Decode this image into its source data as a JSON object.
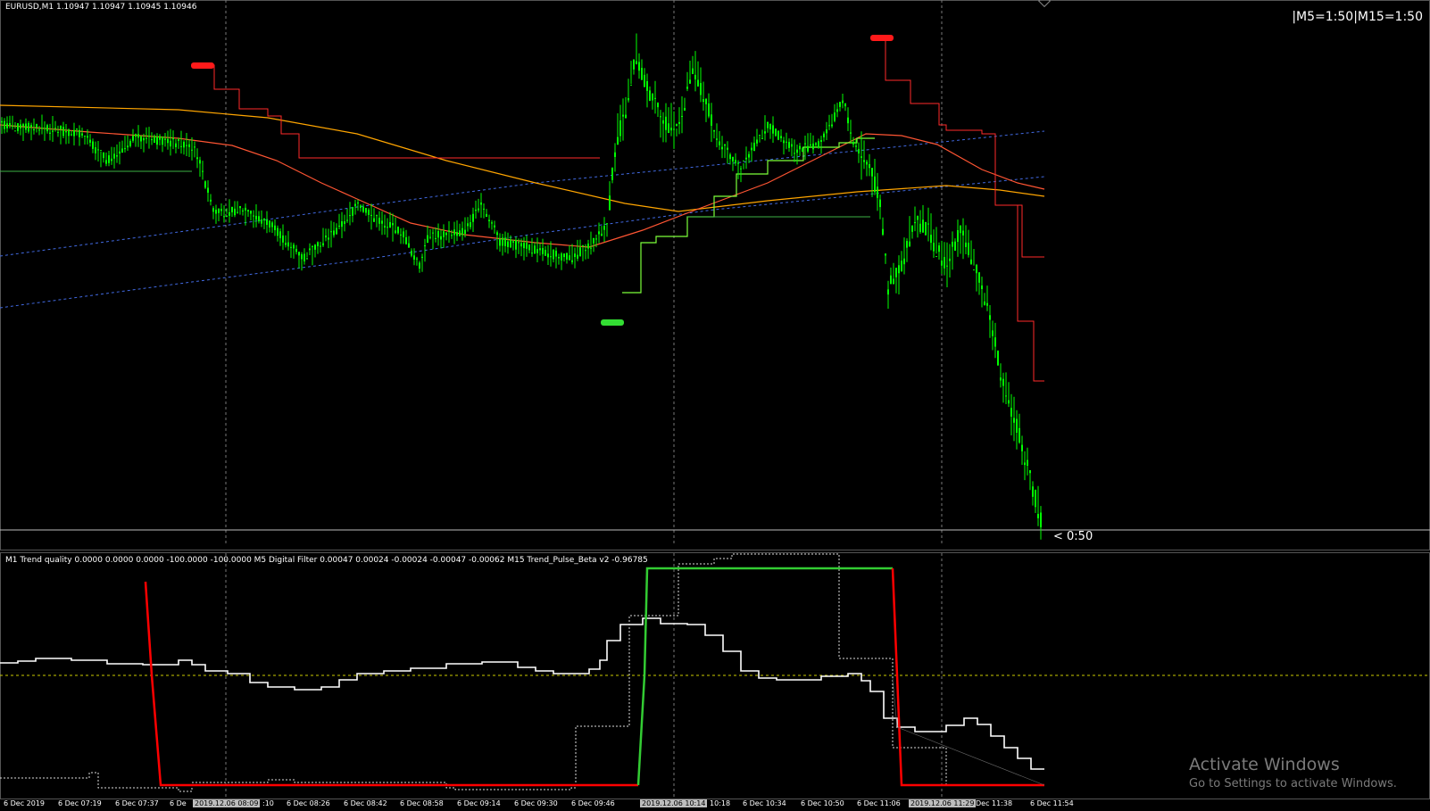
{
  "header": {
    "symbol": "EURUSD,M1  1.10947 1.10947 1.10945 1.10946",
    "timeframes": "|M5=1:50|M15=1:50",
    "countdown": "< 0:50"
  },
  "subwindow": {
    "indicator_label": "M1 Trend quality 0.0000 0.0000 0.0000 -100.0000 -100.0000  M5 Digital Filter 0.00047 0.00024 -0.00024 -0.00047 -0.00062  M15 Trend_Pulse_Beta v2 -0.96785"
  },
  "time_axis": {
    "ticks": [
      {
        "label": "6 Dec 2019",
        "highlight": false
      },
      {
        "label": "6 Dec 07:19",
        "highlight": false
      },
      {
        "label": "6 Dec 07:37",
        "highlight": false
      },
      {
        "label": "6 De",
        "highlight": false
      },
      {
        "label": "2019.12.06 08:09",
        "highlight": true
      },
      {
        "label": ":10",
        "highlight": false
      },
      {
        "label": "6 Dec 08:26",
        "highlight": false
      },
      {
        "label": "6 Dec 08:42",
        "highlight": false
      },
      {
        "label": "6 Dec 08:58",
        "highlight": false
      },
      {
        "label": "6 Dec 09:14",
        "highlight": false
      },
      {
        "label": "6 Dec 09:30",
        "highlight": false
      },
      {
        "label": "6 Dec 09:46",
        "highlight": false
      },
      {
        "label": "2019.12.06 10:14",
        "highlight": true
      },
      {
        "label": "10:18",
        "highlight": false
      },
      {
        "label": "6 Dec 10:34",
        "highlight": false
      },
      {
        "label": "6 Dec 10:50",
        "highlight": false
      },
      {
        "label": "6 Dec 11:06",
        "highlight": false
      },
      {
        "label": "2019.12.06 11:29",
        "highlight": true
      },
      {
        "label": "Dec 11:38",
        "highlight": false
      },
      {
        "label": "6 Dec 11:54",
        "highlight": false
      }
    ]
  },
  "watermark": {
    "title": "Activate Windows",
    "subtitle": "Go to Settings to activate Windows."
  },
  "colors": {
    "background": "#000000",
    "candle": "#00ff00",
    "upper_band": "#ff2a2a",
    "lower_band": "#7cff3a",
    "ma_orange": "#ffa500",
    "dotted_blue": "#4169e1",
    "trend_quality": "#ffffff",
    "digital_filter_red": "#ff0000",
    "digital_filter_green": "#33cc33",
    "level_line": "#cccc00"
  }
}
